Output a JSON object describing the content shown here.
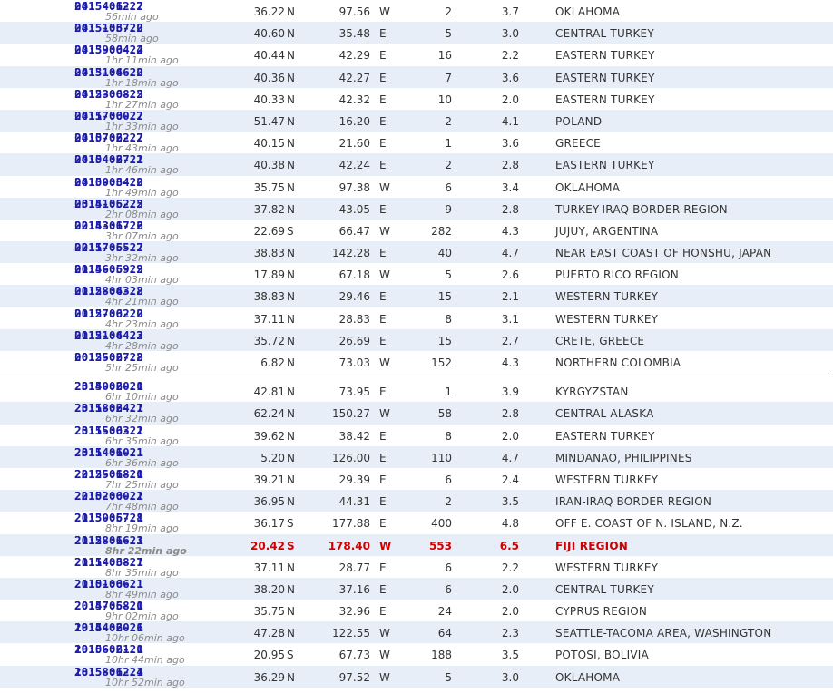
{
  "rows_before": [
    {
      "date": "2015-06-22",
      "time": "04:54:12.7",
      "ago": "56min ago",
      "lat": "36.22",
      "ns": "N",
      "lon": "97.56",
      "ew": "W",
      "depth": "2",
      "mag": "3.7",
      "region": "OKLAHOMA"
    },
    {
      "date": "2015-06-22",
      "time": "04:51:37.0",
      "ago": "58min ago",
      "lat": "40.60",
      "ns": "N",
      "lon": "35.48",
      "ew": "E",
      "depth": "5",
      "mag": "3.0",
      "region": "CENTRAL TURKEY"
    },
    {
      "date": "2015-06-22",
      "time": "04:39:04.4",
      "ago": "1hr 11min ago",
      "lat": "40.44",
      "ns": "N",
      "lon": "42.29",
      "ew": "E",
      "depth": "16",
      "mag": "2.2",
      "region": "EASTERN TURKEY"
    },
    {
      "date": "2015-06-22",
      "time": "04:31:46.0",
      "ago": "1hr 18min ago",
      "lat": "40.36",
      "ns": "N",
      "lon": "42.27",
      "ew": "E",
      "depth": "7",
      "mag": "3.6",
      "region": "EASTERN TURKEY"
    },
    {
      "date": "2015-06-22",
      "time": "04:23:08.5",
      "ago": "1hr 27min ago",
      "lat": "40.33",
      "ns": "N",
      "lon": "42.32",
      "ew": "E",
      "depth": "10",
      "mag": "2.0",
      "region": "EASTERN TURKEY"
    },
    {
      "date": "2015-06-22",
      "time": "04:17:00.7",
      "ago": "1hr 33min ago",
      "lat": "51.47",
      "ns": "N",
      "lon": "16.20",
      "ew": "E",
      "depth": "2",
      "mag": "4.1",
      "region": "POLAND"
    },
    {
      "date": "2015-06-22",
      "time": "04:07:22.7",
      "ago": "1hr 43min ago",
      "lat": "40.15",
      "ns": "N",
      "lon": "21.60",
      "ew": "E",
      "depth": "1",
      "mag": "3.6",
      "region": "GREECE"
    },
    {
      "date": "2015-06-22",
      "time": "04:04:27.1",
      "ago": "1hr 46min ago",
      "lat": "40.38",
      "ns": "N",
      "lon": "42.24",
      "ew": "E",
      "depth": "2",
      "mag": "2.8",
      "region": "EASTERN TURKEY"
    },
    {
      "date": "2015-06-22",
      "time": "04:00:34.0",
      "ago": "1hr 49min ago",
      "lat": "35.75",
      "ns": "N",
      "lon": "97.38",
      "ew": "W",
      "depth": "6",
      "mag": "3.4",
      "region": "OKLAHOMA"
    },
    {
      "date": "2015-06-22",
      "time": "03:41:52.5",
      "ago": "2hr 08min ago",
      "lat": "37.82",
      "ns": "N",
      "lon": "43.05",
      "ew": "E",
      "depth": "9",
      "mag": "2.8",
      "region": "TURKEY-IRAQ BORDER REGION"
    },
    {
      "date": "2015-06-22",
      "time": "02:43:17.6",
      "ago": "3hr 07min ago",
      "lat": "22.69",
      "ns": "S",
      "lon": "66.47",
      "ew": "W",
      "depth": "282",
      "mag": "4.3",
      "region": "JUJUY, ARGENTINA"
    },
    {
      "date": "2015-06-22",
      "time": "02:17:55.7",
      "ago": "3hr 32min ago",
      "lat": "38.83",
      "ns": "N",
      "lon": "142.28",
      "ew": "E",
      "depth": "40",
      "mag": "4.7",
      "region": "NEAR EAST COAST OF HONSHU, JAPAN"
    },
    {
      "date": "2015-06-22",
      "time": "01:46:59.9",
      "ago": "4hr 03min ago",
      "lat": "17.89",
      "ns": "N",
      "lon": "67.18",
      "ew": "W",
      "depth": "5",
      "mag": "2.6",
      "region": "PUERTO RICO REGION"
    },
    {
      "date": "2015-06-22",
      "time": "01:28:43.8",
      "ago": "4hr 21min ago",
      "lat": "38.83",
      "ns": "N",
      "lon": "29.46",
      "ew": "E",
      "depth": "15",
      "mag": "2.1",
      "region": "WESTERN TURKEY"
    },
    {
      "date": "2015-06-22",
      "time": "01:27:02.0",
      "ago": "4hr 23min ago",
      "lat": "37.11",
      "ns": "N",
      "lon": "28.83",
      "ew": "E",
      "depth": "8",
      "mag": "3.1",
      "region": "WESTERN TURKEY"
    },
    {
      "date": "2015-06-22",
      "time": "01:21:44.3",
      "ago": "4hr 28min ago",
      "lat": "35.72",
      "ns": "N",
      "lon": "26.69",
      "ew": "E",
      "depth": "15",
      "mag": "2.7",
      "region": "CRETE, GREECE"
    },
    {
      "date": "2015-06-22",
      "time": "00:25:27.8",
      "ago": "5hr 25min ago",
      "lat": "6.82",
      "ns": "N",
      "lon": "73.03",
      "ew": "W",
      "depth": "152",
      "mag": "4.3",
      "region": "NORTHERN COLOMBIA"
    }
  ],
  "rows_after": [
    {
      "date": "2015-06-21",
      "time": "23:40:20.0",
      "ago": "6hr 10min ago",
      "lat": "42.81",
      "ns": "N",
      "lon": "73.95",
      "ew": "E",
      "depth": "1",
      "mag": "3.9",
      "region": "KYRGYZSTAN"
    },
    {
      "date": "2015-06-21",
      "time": "23:18:24.7",
      "ago": "6hr 32min ago",
      "lat": "62.24",
      "ns": "N",
      "lon": "150.27",
      "ew": "W",
      "depth": "58",
      "mag": "2.8",
      "region": "CENTRAL ALASKA"
    },
    {
      "date": "2015-06-21",
      "time": "23:15:03.2",
      "ago": "6hr 35min ago",
      "lat": "39.62",
      "ns": "N",
      "lon": "38.42",
      "ew": "E",
      "depth": "8",
      "mag": "2.0",
      "region": "EASTERN TURKEY"
    },
    {
      "date": "2015-06-21",
      "time": "23:14:10.1",
      "ago": "6hr 36min ago",
      "lat": "5.20",
      "ns": "N",
      "lon": "126.00",
      "ew": "E",
      "depth": "110",
      "mag": "4.7",
      "region": "MINDANAO, PHILIPPINES"
    },
    {
      "date": "2015-06-21",
      "time": "22:25:18.0",
      "ago": "7hr 25min ago",
      "lat": "39.21",
      "ns": "N",
      "lon": "29.39",
      "ew": "E",
      "depth": "6",
      "mag": "2.4",
      "region": "WESTERN TURKEY"
    },
    {
      "date": "2015-06-21",
      "time": "22:02:00.2",
      "ago": "7hr 48min ago",
      "lat": "36.95",
      "ns": "N",
      "lon": "44.31",
      "ew": "E",
      "depth": "2",
      "mag": "3.5",
      "region": "IRAN-IRAQ BORDER REGION"
    },
    {
      "date": "2015-06-21",
      "time": "21:30:57.8",
      "ago": "8hr 19min ago",
      "lat": "36.17",
      "ns": "S",
      "lon": "177.88",
      "ew": "E",
      "depth": "400",
      "mag": "4.8",
      "region": "OFF E. COAST OF N. ISLAND, N.Z."
    },
    {
      "date": "2015-06-21",
      "time": "21:28:16.3",
      "ago": "8hr 22min ago",
      "lat": "20.42",
      "ns": "S",
      "lon": "178.40",
      "ew": "W",
      "depth": "553",
      "mag": "6.5",
      "region": "FIJI REGION",
      "highlight": true
    },
    {
      "date": "2015-06-21",
      "time": "21:14:38.7",
      "ago": "8hr 35min ago",
      "lat": "37.11",
      "ns": "N",
      "lon": "28.77",
      "ew": "E",
      "depth": "6",
      "mag": "2.2",
      "region": "WESTERN TURKEY"
    },
    {
      "date": "2015-06-21",
      "time": "21:01:06.1",
      "ago": "8hr 49min ago",
      "lat": "38.20",
      "ns": "N",
      "lon": "37.16",
      "ew": "E",
      "depth": "6",
      "mag": "2.0",
      "region": "CENTRAL TURKEY"
    },
    {
      "date": "2015-06-21",
      "time": "20:47:58.0",
      "ago": "9hr 02min ago",
      "lat": "35.75",
      "ns": "N",
      "lon": "32.96",
      "ew": "E",
      "depth": "24",
      "mag": "2.0",
      "region": "CYPRUS REGION"
    },
    {
      "date": "2015-06-21",
      "time": "19:44:20.6",
      "ago": "10hr 06min ago",
      "lat": "47.28",
      "ns": "N",
      "lon": "122.55",
      "ew": "W",
      "depth": "64",
      "mag": "2.3",
      "region": "SEATTLE-TACOMA AREA, WASHINGTON"
    },
    {
      "date": "2015-06-21",
      "time": "19:06:21.0",
      "ago": "10hr 44min ago",
      "lat": "20.95",
      "ns": "S",
      "lon": "67.73",
      "ew": "W",
      "depth": "188",
      "mag": "3.5",
      "region": "POTOSI, BOLIVIA"
    },
    {
      "date": "2015-06-21",
      "time": "18:58:12.4",
      "ago": "10hr 52min ago",
      "lat": "36.29",
      "ns": "N",
      "lon": "97.52",
      "ew": "W",
      "depth": "5",
      "mag": "3.0",
      "region": "OKLAHOMA"
    }
  ],
  "colors": {
    "row_alt": "#e8eef7",
    "link": "#1c1caa",
    "ago": "#8a8a8a",
    "highlight": "#d00000"
  }
}
